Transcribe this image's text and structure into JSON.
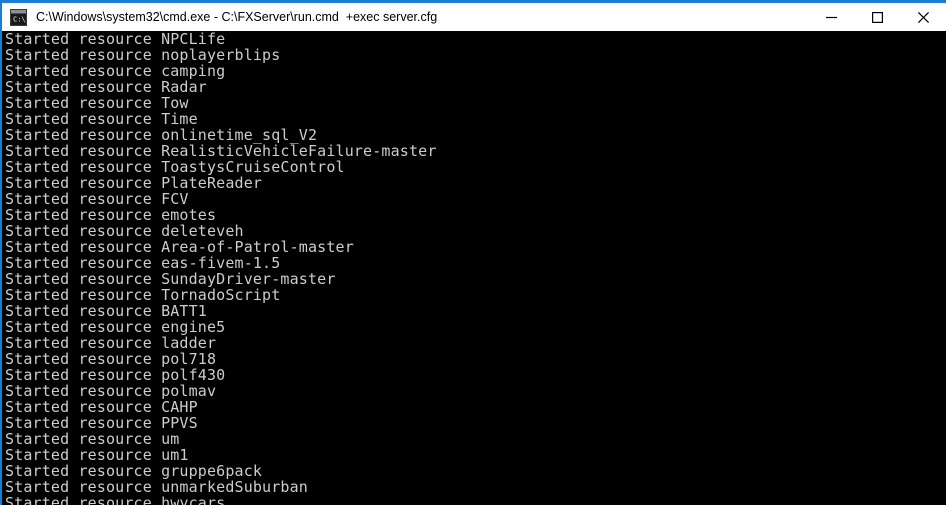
{
  "window": {
    "title": "C:\\Windows\\system32\\cmd.exe - C:\\FXServer\\run.cmd  +exec server.cfg",
    "icon": "cmd-console-icon",
    "accent_color": "#1a7fd4",
    "titlebar_bg": "#ffffff",
    "titlebar_fg": "#000000",
    "console_bg": "#000000",
    "console_fg": "#cccccc",
    "controls": {
      "minimize_label": "—",
      "maximize_label": "☐",
      "close_label": "✕"
    }
  },
  "console": {
    "lines": [
      "Started resource NPCLife",
      "Started resource noplayerblips",
      "Started resource camping",
      "Started resource Radar",
      "Started resource Tow",
      "Started resource Time",
      "Started resource onlinetime_sql_V2",
      "Started resource RealisticVehicleFailure-master",
      "Started resource ToastysCruiseControl",
      "Started resource PlateReader",
      "Started resource FCV",
      "Started resource emotes",
      "Started resource deleteveh",
      "Started resource Area-of-Patrol-master",
      "Started resource eas-fivem-1.5",
      "Started resource SundayDriver-master",
      "Started resource TornadoScript",
      "Started resource BATT1",
      "Started resource engine5",
      "Started resource ladder",
      "Started resource pol718",
      "Started resource polf430",
      "Started resource polmav",
      "Started resource CAHP",
      "Started resource PPVS",
      "Started resource um",
      "Started resource um1",
      "Started resource gruppe6pack",
      "Started resource unmarkedSuburban",
      "Started resource hwycars"
    ]
  }
}
